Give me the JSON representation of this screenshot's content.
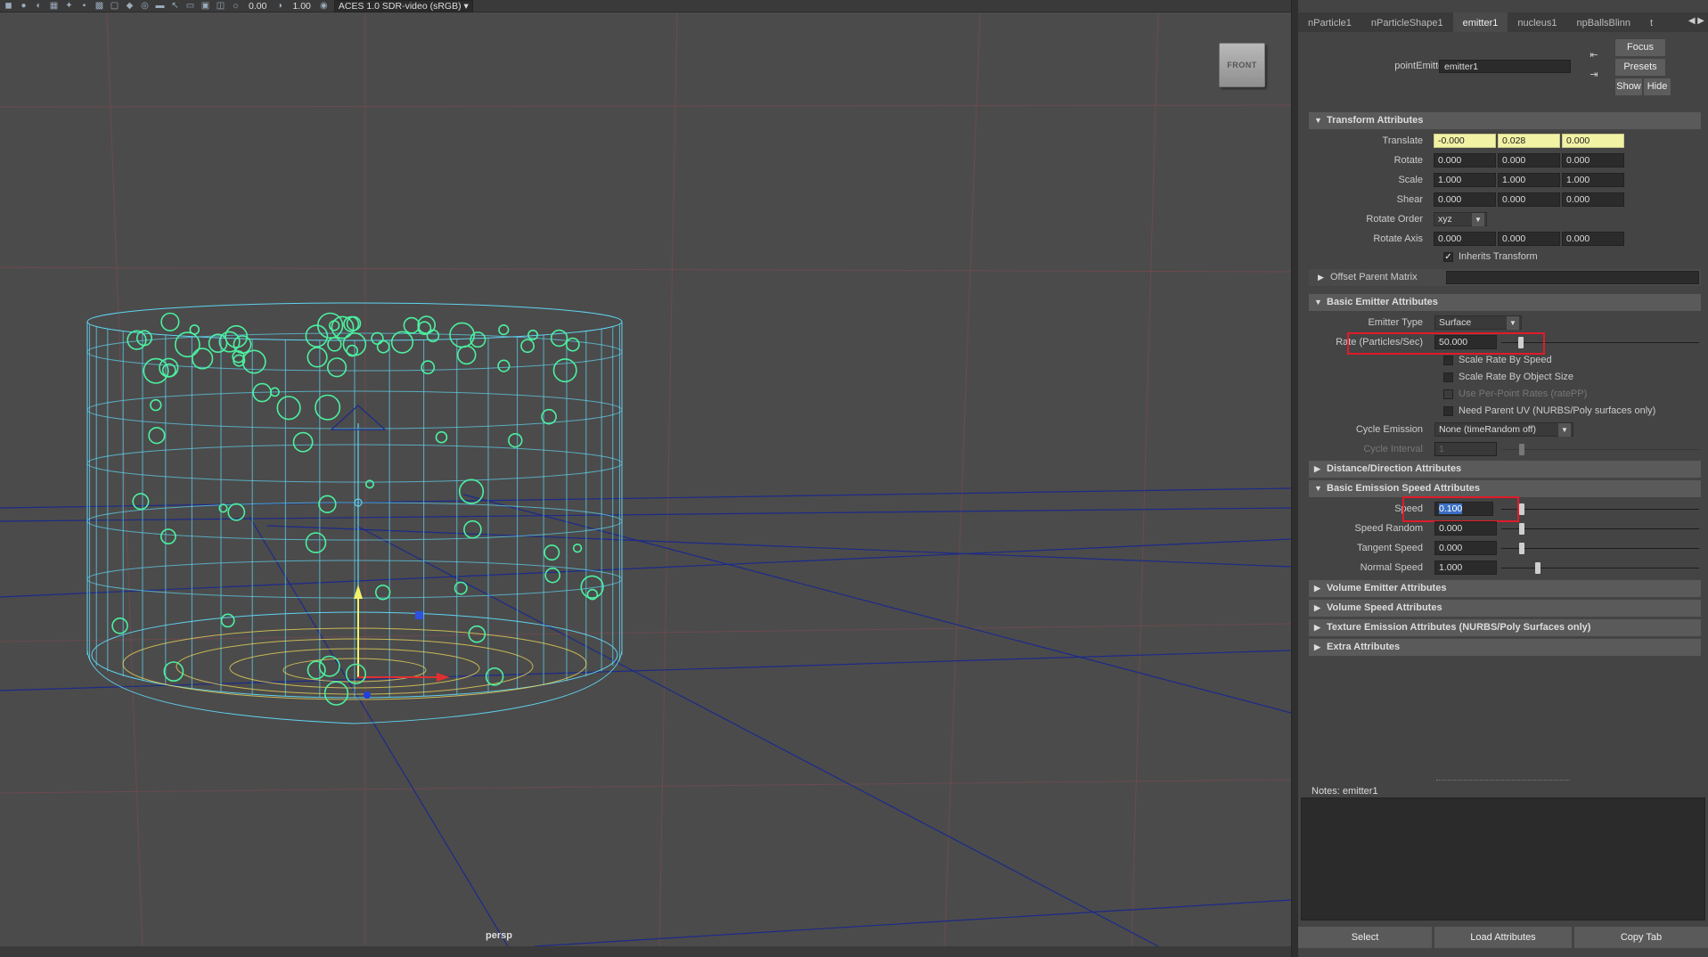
{
  "toolbar": {
    "icons": [
      "cube-icon",
      "sphere-icon",
      "shading-icon",
      "texture-icon",
      "light-icon",
      "shadow-icon",
      "wireframe-icon",
      "xray-icon",
      "isolate-icon",
      "grid-icon",
      "camera-icon",
      "select-icon",
      "snap-icon",
      "layout-icon",
      "resolution-icon",
      "exposure-icon",
      "gamma-icon",
      "colorspace-icon"
    ],
    "exposure_value": "0.00",
    "gamma_value": "1.00",
    "colorspace": "ACES 1.0 SDR-video (sRGB)"
  },
  "viewport": {
    "view_cube_label": "FRONT",
    "camera_label": "persp"
  },
  "attribute_editor": {
    "tabs": [
      "nParticle1",
      "nParticleShape1",
      "emitter1",
      "nucleus1",
      "npBallsBlinn",
      "t"
    ],
    "active_tab": "emitter1",
    "node_type_label": "pointEmitter:",
    "node_name": "emitter1",
    "focus_label": "Focus",
    "presets_label": "Presets",
    "show_label": "Show",
    "hide_label": "Hide",
    "sections": {
      "transform": "Transform Attributes",
      "offset_parent": "Offset Parent Matrix",
      "basic_emitter": "Basic Emitter Attributes",
      "distance_direction": "Distance/Direction Attributes",
      "basic_emission_speed": "Basic Emission Speed Attributes",
      "volume_emitter": "Volume Emitter Attributes",
      "volume_speed": "Volume Speed Attributes",
      "texture_emission": "Texture Emission Attributes (NURBS/Poly Surfaces only)",
      "extra": "Extra Attributes"
    },
    "transform": {
      "translate_label": "Translate",
      "translate": [
        "-0.000",
        "0.028",
        "0.000"
      ],
      "rotate_label": "Rotate",
      "rotate": [
        "0.000",
        "0.000",
        "0.000"
      ],
      "scale_label": "Scale",
      "scale": [
        "1.000",
        "1.000",
        "1.000"
      ],
      "shear_label": "Shear",
      "shear": [
        "0.000",
        "0.000",
        "0.000"
      ],
      "rotate_order_label": "Rotate Order",
      "rotate_order": "xyz",
      "rotate_axis_label": "Rotate Axis",
      "rotate_axis": [
        "0.000",
        "0.000",
        "0.000"
      ],
      "inherits_transform_label": "Inherits Transform",
      "inherits_transform": true
    },
    "basic_emitter": {
      "emitter_type_label": "Emitter Type",
      "emitter_type": "Surface",
      "rate_label": "Rate (Particles/Sec)",
      "rate": "50.000",
      "rate_slider": 0.1,
      "scale_rate_by_speed_label": "Scale Rate By Speed",
      "scale_rate_by_object_size_label": "Scale Rate By Object Size",
      "use_per_point_rates_label": "Use Per-Point Rates (ratePP)",
      "need_parent_uv_label": "Need Parent UV (NURBS/Poly surfaces only)",
      "cycle_emission_label": "Cycle Emission",
      "cycle_emission": "None (timeRandom off)",
      "cycle_interval_label": "Cycle Interval",
      "cycle_interval": "1"
    },
    "basic_emission_speed": {
      "speed_label": "Speed",
      "speed": "0.100",
      "speed_random_label": "Speed Random",
      "speed_random": "0.000",
      "tangent_speed_label": "Tangent Speed",
      "tangent_speed": "0.000",
      "normal_speed_label": "Normal Speed",
      "normal_speed": "1.000"
    },
    "notes_label": "Notes:  emitter1",
    "bottom_buttons": [
      "Select",
      "Load Attributes",
      "Copy Tab"
    ]
  },
  "colors": {
    "highlight": "#e01b2a",
    "wireframe": "#5fd3f0",
    "particles": "#4cf0a0",
    "keyed_field": "#f2f2a4"
  }
}
